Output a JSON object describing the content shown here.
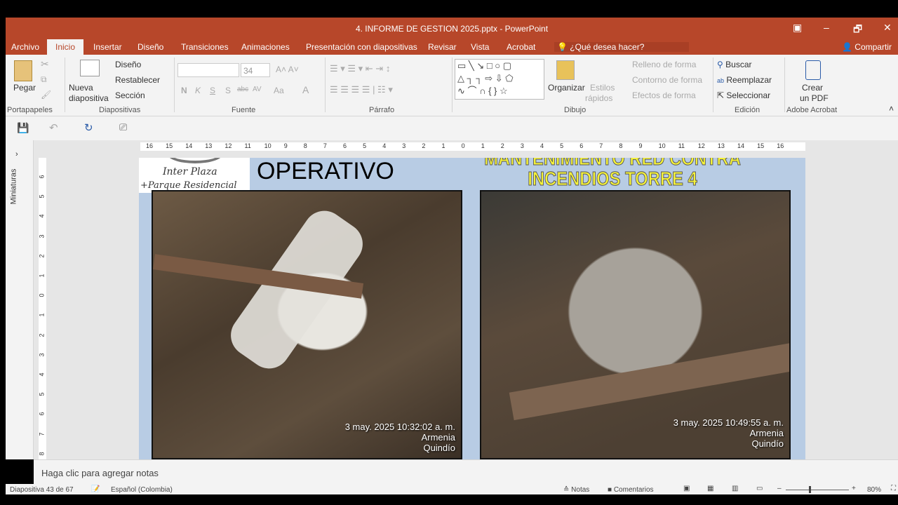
{
  "window": {
    "title": "4. INFORME DE GESTION 2025.pptx - PowerPoint",
    "restore_icon": "▣",
    "min": "–",
    "max": "🗗",
    "close": "✕"
  },
  "tabs": [
    "Archivo",
    "Inicio",
    "Insertar",
    "Diseño",
    "Transiciones",
    "Animaciones",
    "Presentación con diapositivas",
    "Revisar",
    "Vista",
    "Acrobat"
  ],
  "tell_me": "¿Qué desea hacer?",
  "share": "Compartir",
  "ribbon": {
    "clipboard": {
      "paste": "Pegar",
      "group": "Portapapeles"
    },
    "slides": {
      "new": "Nueva",
      "new2": "diapositiva",
      "layout": "Diseño",
      "reset": "Restablecer",
      "section": "Sección",
      "group": "Diapositivas"
    },
    "font": {
      "name": "",
      "size": "34",
      "bold": "N",
      "italic": "K",
      "underline": "S",
      "shadow": "S",
      "strike": "abc",
      "spacing": "AV",
      "case": "Aa",
      "color": "A",
      "group": "Fuente"
    },
    "paragraph": {
      "group": "Párrafo"
    },
    "drawing": {
      "arrange": "Organizar",
      "styles": "Estilos",
      "styles2": "rápidos",
      "fill": "Relleno de forma",
      "outline": "Contorno de forma",
      "effects": "Efectos de forma",
      "group": "Dibujo"
    },
    "editing": {
      "find": "Buscar",
      "replace": "Reemplazar",
      "select": "Seleccionar",
      "group": "Edición"
    },
    "acrobat": {
      "create": "Crear",
      "create2": "un PDF",
      "group": "Adobe Acrobat"
    }
  },
  "thumbnails_label": "Miniaturas",
  "hruler": [
    "16",
    "15",
    "14",
    "13",
    "12",
    "11",
    "10",
    "9",
    "8",
    "7",
    "6",
    "5",
    "4",
    "3",
    "2",
    "1",
    "0",
    "1",
    "2",
    "3",
    "4",
    "5",
    "6",
    "7",
    "8",
    "9",
    "10",
    "11",
    "12",
    "13",
    "14",
    "15",
    "16"
  ],
  "vruler": [
    "6",
    "5",
    "4",
    "3",
    "2",
    "1",
    "0",
    "1",
    "2",
    "3",
    "4",
    "5",
    "6",
    "7",
    "8"
  ],
  "slide": {
    "logo_line1": "Inter Plaza",
    "logo_line2": "+Parque Residencial",
    "heading": "OPERATIVO",
    "title_line1": "MANTENIMIENTO RED CONTRA",
    "title_line2": "INCENDIOS TORRE 4",
    "photo1": {
      "stamp": "3 may. 2025 10:32:02 a. m.",
      "place": "Armenia",
      "place2": "Quindío"
    },
    "photo2": {
      "stamp": "3 may. 2025 10:49:55 a. m.",
      "place": "Armenia",
      "place2": "Quindío"
    }
  },
  "notes_placeholder": "Haga clic para agregar notas",
  "status": {
    "slide": "Diapositiva 43 de 67",
    "language": "Español (Colombia)",
    "notes": "Notas",
    "comments": "Comentarios",
    "zoom": "80%"
  }
}
